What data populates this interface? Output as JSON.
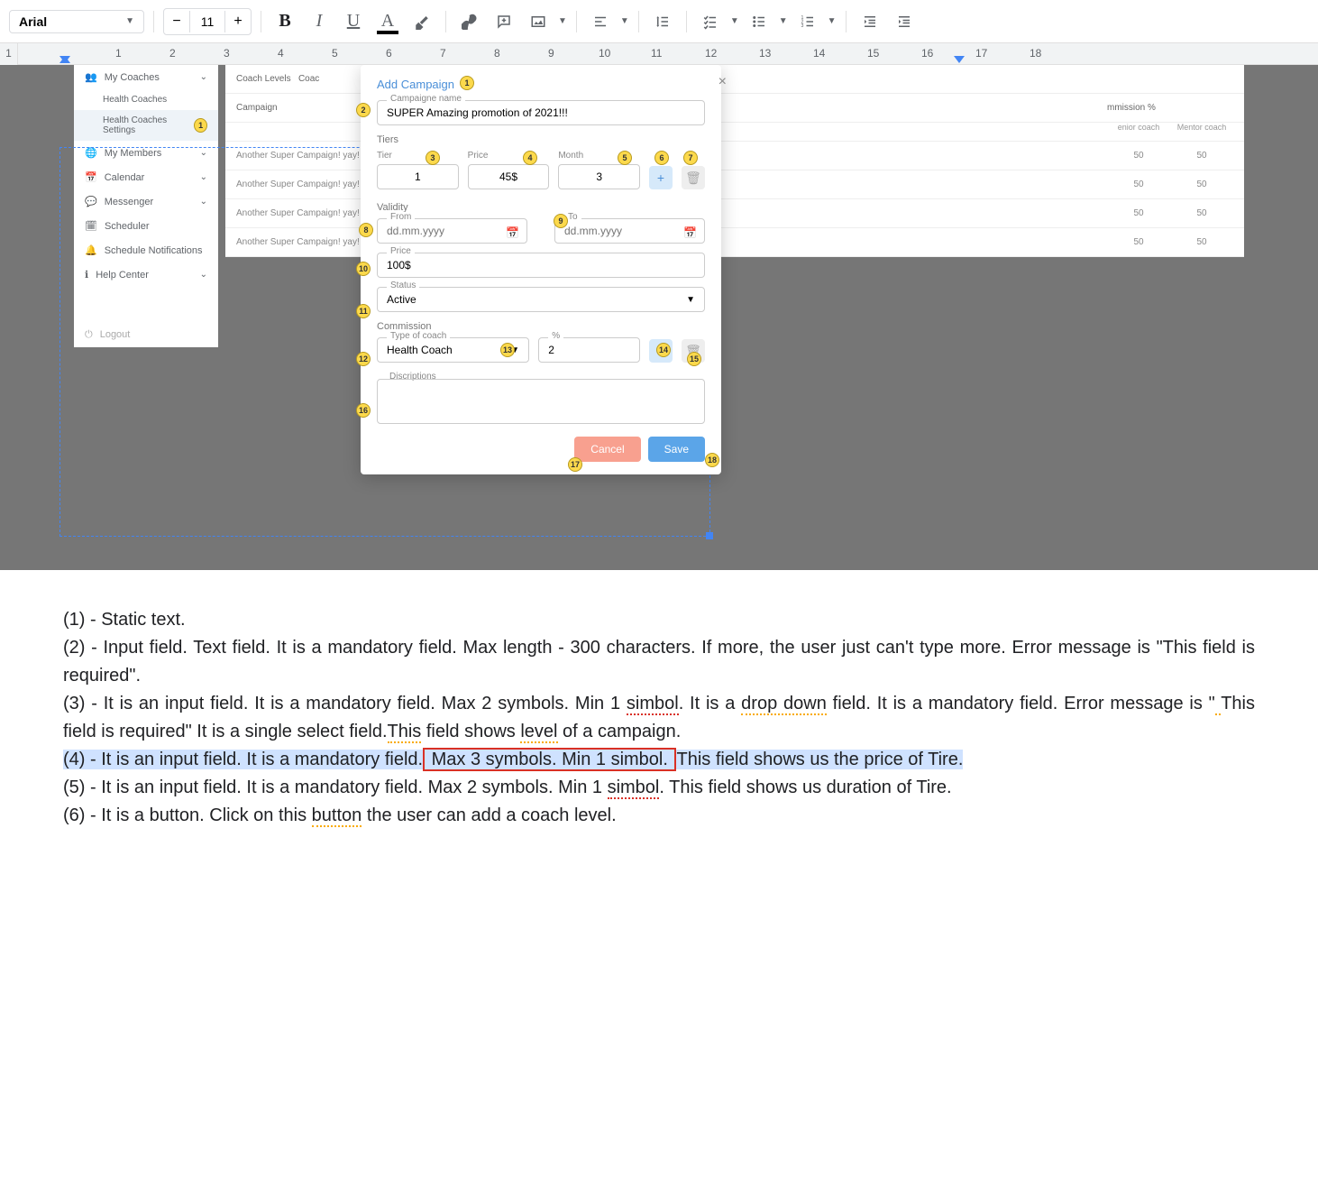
{
  "toolbar": {
    "font_name": "Arial",
    "font_size": "11",
    "bold": "B",
    "italic": "I",
    "underline": "U",
    "text_color": "A"
  },
  "ruler": {
    "corner": "1",
    "marks": [
      "1",
      "2",
      "3",
      "4",
      "5",
      "6",
      "7",
      "8",
      "9",
      "10",
      "11",
      "12",
      "13",
      "14",
      "15",
      "16",
      "17",
      "18"
    ]
  },
  "sidebar": {
    "items": [
      {
        "label": "My Coaches"
      },
      {
        "label": "Health Coaches",
        "sub": true
      },
      {
        "label": "Health Coaches Settings",
        "sub": true,
        "badge": "1"
      },
      {
        "label": "My Members"
      },
      {
        "label": "Calendar"
      },
      {
        "label": "Messenger"
      },
      {
        "label": "Scheduler"
      },
      {
        "label": "Schedule Notifications"
      },
      {
        "label": "Help Center"
      }
    ],
    "logout": "Logout"
  },
  "bg_table": {
    "tab1": "Coach Levels",
    "tab2": "Coac",
    "header_campaign": "Campaign",
    "header_commission": "mmission %",
    "header_c2": "enior coach",
    "header_c3": "Mentor coach",
    "rows": [
      {
        "name": "Another Super Campaign! yay!",
        "v1": "50",
        "v2": "50"
      },
      {
        "name": "Another Super Campaign! yay!",
        "v1": "50",
        "v2": "50"
      },
      {
        "name": "Another Super Campaign! yay!",
        "v1": "50",
        "v2": "50"
      },
      {
        "name": "Another Super Campaign! yay!",
        "v1": "50",
        "v2": "50"
      }
    ]
  },
  "modal": {
    "title": "Add Campaign",
    "campaign_name_label": "Campaigne name",
    "campaign_name_value": "SUPER Amazing promotion of 2021!!!",
    "tiers_label": "Tiers",
    "tier_col": "Tier",
    "price_col": "Price",
    "month_col": "Month",
    "tier_val": "1",
    "price_val": "45$",
    "month_val": "3",
    "validity_label": "Validity",
    "from_label": "From",
    "to_label": "To",
    "date_placeholder": "dd.mm.yyyy",
    "price_label": "Price",
    "price_value": "100$",
    "status_label": "Status",
    "status_value": "Active",
    "commission_label": "Commission",
    "type_coach_label": "Type of coach",
    "type_coach_value": "Health Coach",
    "percent_label": "%",
    "percent_value": "2",
    "descriptions_label": "Discriptions",
    "cancel": "Cancel",
    "save": "Save"
  },
  "markers": {
    "m1": "1",
    "m2": "2",
    "m3": "3",
    "m4": "4",
    "m5": "5",
    "m6": "6",
    "m7": "7",
    "m8": "8",
    "m9": "9",
    "m10": "10",
    "m11": "11",
    "m12": "12",
    "m13": "13",
    "m14": "14",
    "m15": "15",
    "m16": "16",
    "m17": "17",
    "m18": "18"
  },
  "doc": {
    "p1": "(1) - Static text.",
    "p2": "(2) - Input field. Text field. It is a mandatory field. Max length  - 300 characters. If more, the user just can't type more. Error message is \"This field is required\".",
    "p3a": "(3) - It is an input field. It is a mandatory field. Max 2 symbols. Min 1 ",
    "p3_simbol": "simbol",
    "p3b": ". It is a ",
    "p3_dropdown": "drop down",
    "p3c": " field. It is a mandatory field. Error message is \"",
    "p3_space": " ",
    "p3d": "This field is required\" It is a single select ",
    "p3e": "field.",
    "p3_this": "This",
    "p3f": " field shows ",
    "p3_level": "level",
    "p3g": " of a campaign.",
    "p4a": "(4) - It is an input field. It is a mandatory field.",
    "p4_box": " Max 3 symbols. Min 1 simbol. ",
    "p4b": "This field shows us the price of Tire.",
    "p5a": "(5) - It is an input field. It is a mandatory field. Max 2 symbols. Min 1 ",
    "p5_simbol": "simbol",
    "p5b": ". This field shows us duration of Tire.",
    "p6a": "(6) - It is a button. Click on this ",
    "p6_button": "button",
    "p6b": " the  user can add a coach level."
  }
}
